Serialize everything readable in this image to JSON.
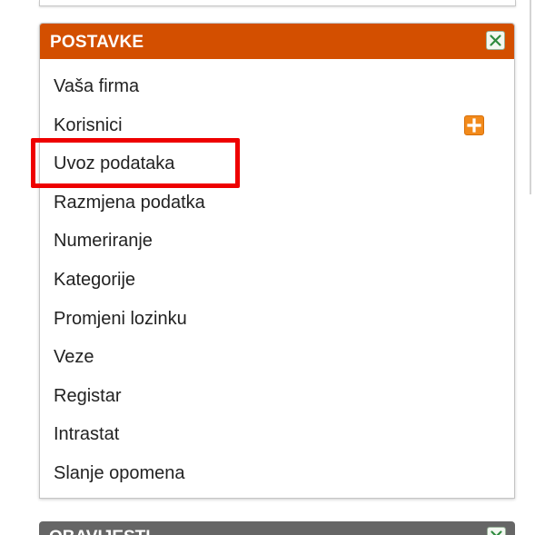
{
  "panel": {
    "title": "POSTAVKE",
    "header_color": "#d34f00",
    "close_icon": "close-icon",
    "items": [
      {
        "label": "Vaša firma"
      },
      {
        "label": "Korisnici",
        "action_icon": "plus-icon"
      },
      {
        "label": "Uvoz podataka",
        "highlighted": true
      },
      {
        "label": "Razmjena podatka"
      },
      {
        "label": "Numeriranje"
      },
      {
        "label": "Kategorije"
      },
      {
        "label": "Promjeni lozinku"
      },
      {
        "label": "Veze"
      },
      {
        "label": "Registar"
      },
      {
        "label": "Intrastat"
      },
      {
        "label": "Slanje opomena"
      }
    ]
  },
  "next_panel": {
    "title": "OBAVIJESTI",
    "header_color": "#666666"
  },
  "highlight_color": "#ee0000"
}
